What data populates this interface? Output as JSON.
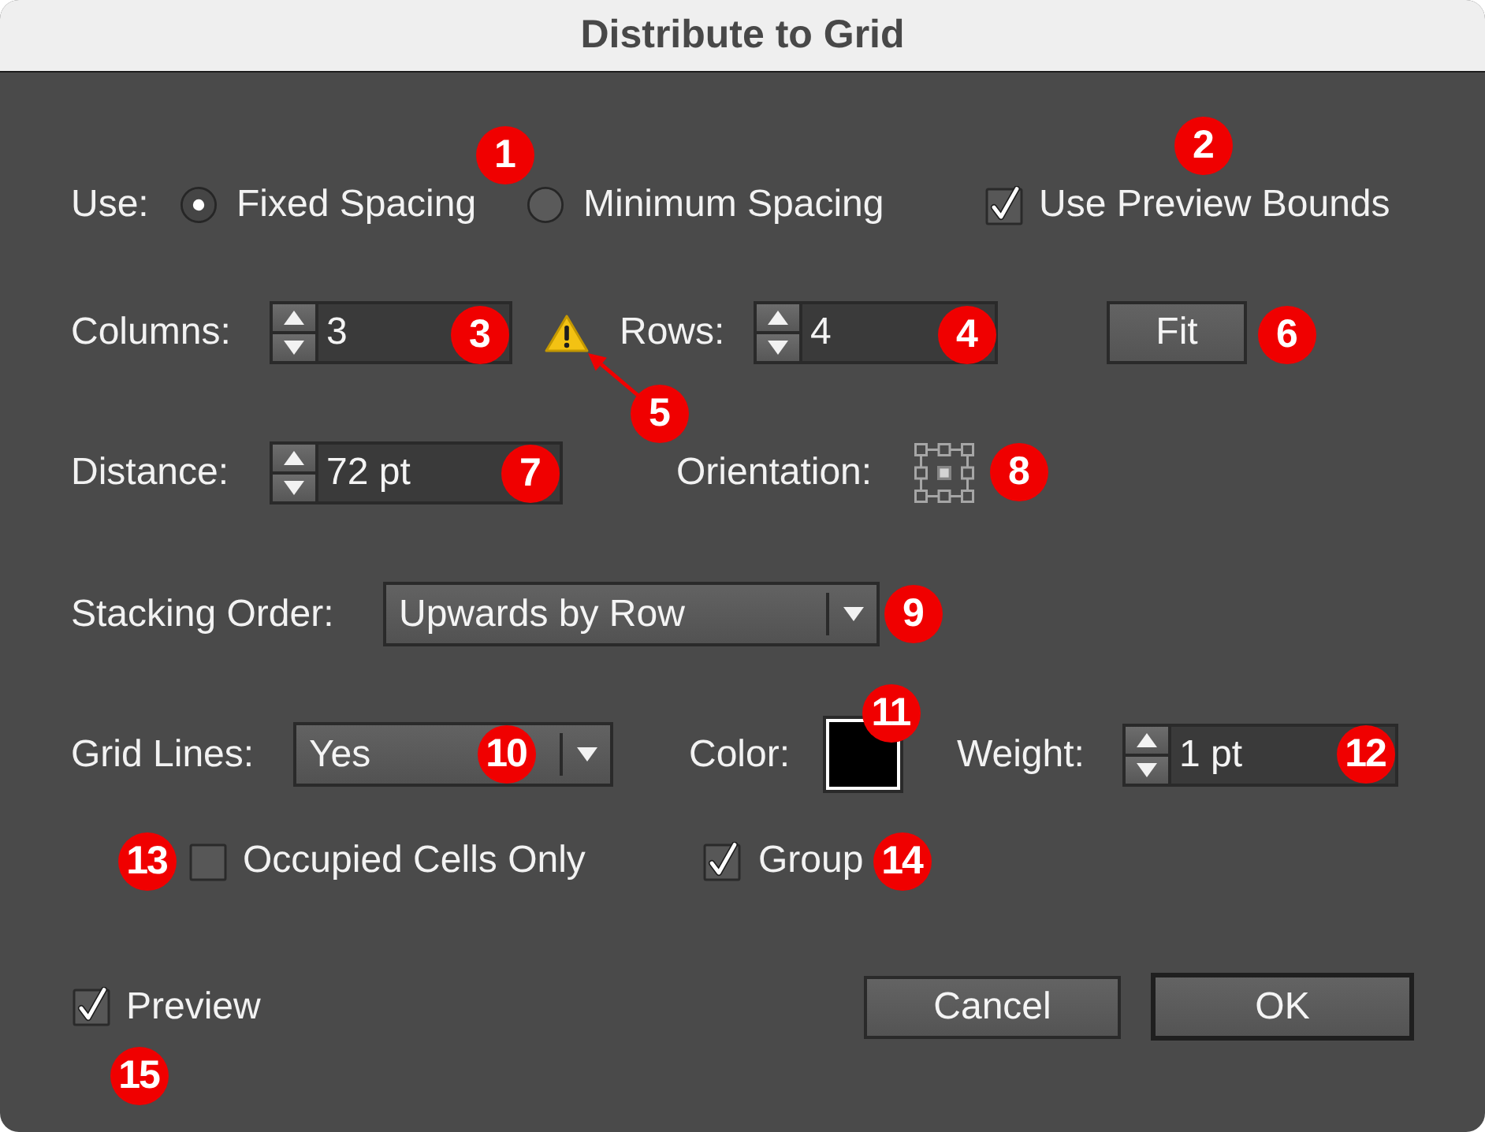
{
  "window": {
    "title": "Distribute to Grid"
  },
  "use": {
    "label": "Use:",
    "options": [
      {
        "label": "Fixed Spacing",
        "selected": true
      },
      {
        "label": "Minimum Spacing",
        "selected": false
      }
    ]
  },
  "use_preview_bounds": {
    "label": "Use Preview Bounds",
    "checked": true
  },
  "columns": {
    "label": "Columns:",
    "value": "3"
  },
  "warning": true,
  "rows": {
    "label": "Rows:",
    "value": "4"
  },
  "fit": {
    "label": "Fit"
  },
  "distance": {
    "label": "Distance:",
    "value": "72 pt"
  },
  "orientation": {
    "label": "Orientation:"
  },
  "stacking_order": {
    "label": "Stacking Order:",
    "value": "Upwards by Row"
  },
  "grid_lines": {
    "label": "Grid Lines:",
    "value": "Yes"
  },
  "color": {
    "label": "Color:",
    "color": "#000000"
  },
  "weight": {
    "label": "Weight:",
    "value": "1 pt"
  },
  "occupied_cells_only": {
    "label": "Occupied Cells Only",
    "checked": false
  },
  "group": {
    "label": "Group",
    "checked": true
  },
  "preview": {
    "label": "Preview",
    "checked": true
  },
  "buttons": [
    {
      "label": "Cancel",
      "default": false
    },
    {
      "label": "OK",
      "default": true
    }
  ],
  "callouts": [
    {
      "number": "1"
    },
    {
      "number": "2"
    },
    {
      "number": "3"
    },
    {
      "number": "4"
    },
    {
      "number": "5"
    },
    {
      "number": "6"
    },
    {
      "number": "7"
    },
    {
      "number": "8"
    },
    {
      "number": "9"
    },
    {
      "number": "10"
    },
    {
      "number": "11"
    },
    {
      "number": "12"
    },
    {
      "number": "13"
    },
    {
      "number": "14"
    },
    {
      "number": "15"
    }
  ]
}
